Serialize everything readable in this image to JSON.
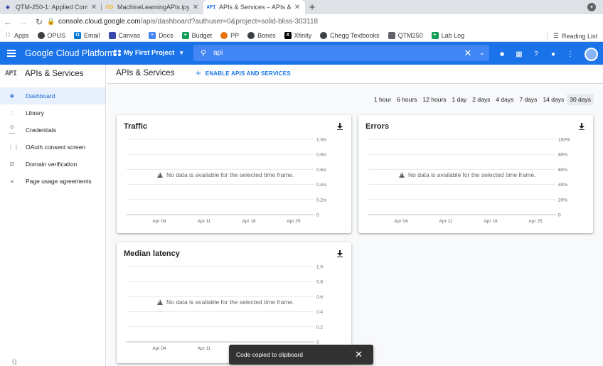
{
  "browser": {
    "tabs": [
      {
        "title": "QTM-250-1: Applied Computing",
        "icon": "shield-icon",
        "icon_color": "#3949ab"
      },
      {
        "title": "MachineLearningAPIs.ipynb - C",
        "icon": "colab-icon",
        "icon_color": "#f9ab00"
      },
      {
        "title": "APIs & Services – APIs & Servic",
        "icon": "api-icon",
        "icon_color": "#1a73e8",
        "active": true
      }
    ],
    "url_host": "console.cloud.google.com",
    "url_rest": "/apis/dashboard?authuser=0&project=solid-bliss-303118",
    "profile_initial": "E",
    "bookmarks": [
      {
        "label": "Apps",
        "icon": "apps-grid-icon",
        "color": "#5f6368"
      },
      {
        "label": "OPUS",
        "icon": "globe-icon",
        "color": "#3c4043"
      },
      {
        "label": "Email",
        "icon": "outlook-icon",
        "color": "#0078d4"
      },
      {
        "label": "Canvas",
        "icon": "shield-icon",
        "color": "#3949ab"
      },
      {
        "label": "Docs",
        "icon": "docs-icon",
        "color": "#4285f4"
      },
      {
        "label": "Budget",
        "icon": "sheets-icon",
        "color": "#0f9d58"
      },
      {
        "label": "PP",
        "icon": "pp-icon",
        "color": "#e8710a"
      },
      {
        "label": "Bones",
        "icon": "globe-icon",
        "color": "#3c4043"
      },
      {
        "label": "Xfinity",
        "icon": "x-icon",
        "color": "#000000"
      },
      {
        "label": "Chegg Textbooks",
        "icon": "globe-icon",
        "color": "#3c4043"
      },
      {
        "label": "QTM250",
        "icon": "folder-icon",
        "color": "#5f6368"
      },
      {
        "label": "Lab Log",
        "icon": "sheets-icon",
        "color": "#0f9d58"
      }
    ],
    "reading_list": "Reading List"
  },
  "header": {
    "product": "Google Cloud Platform",
    "project": "My First Project",
    "search_value": "api"
  },
  "sidebar": {
    "logo": "API",
    "title": "APIs & Services",
    "items": [
      {
        "label": "Dashboard",
        "icon": "dashboard-icon",
        "active": true
      },
      {
        "label": "Library",
        "icon": "library-icon"
      },
      {
        "label": "Credentials",
        "icon": "key-icon"
      },
      {
        "label": "OAuth consent screen",
        "icon": "consent-icon"
      },
      {
        "label": "Domain verification",
        "icon": "checkbox-icon"
      },
      {
        "label": "Page usage agreements",
        "icon": "settings-list-icon"
      }
    ]
  },
  "main": {
    "page_title": "APIs & Services",
    "enable_button": "ENABLE APIS AND SERVICES",
    "time_ranges": [
      "1 hour",
      "6 hours",
      "12 hours",
      "1 day",
      "2 days",
      "4 days",
      "7 days",
      "14 days",
      "30 days"
    ],
    "selected_range": "30 days",
    "no_data": "No data is available for the selected time frame."
  },
  "chart_data": [
    {
      "type": "line",
      "title": "Traffic",
      "x": [
        "Apr 04",
        "Apr 11",
        "Apr 18",
        "Apr 25"
      ],
      "y_ticks": [
        "1.0/s",
        "0.8/s",
        "0.6/s",
        "0.4/s",
        "0.2/s",
        "0"
      ],
      "ylim": [
        0,
        1.0
      ],
      "series": [],
      "grid": true
    },
    {
      "type": "line",
      "title": "Errors",
      "x": [
        "Apr 04",
        "Apr 11",
        "Apr 18",
        "Apr 25"
      ],
      "y_ticks": [
        "100%",
        "80%",
        "60%",
        "40%",
        "20%",
        "0"
      ],
      "ylim": [
        0,
        100
      ],
      "series": [],
      "grid": true
    },
    {
      "type": "line",
      "title": "Median latency",
      "x": [
        "Apr 04",
        "Apr 11",
        "Apr 18",
        "Apr 25"
      ],
      "y_ticks": [
        "1.0",
        "0.8",
        "0.6",
        "0.4",
        "0.2",
        "0"
      ],
      "ylim": [
        0,
        1.0
      ],
      "series": [],
      "grid": true
    }
  ],
  "toast": {
    "message": "Code copied to clipboard"
  }
}
